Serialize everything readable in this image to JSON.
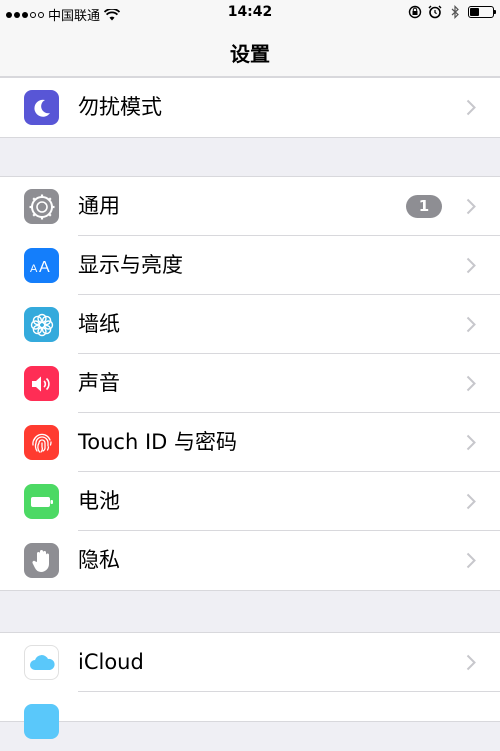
{
  "status_bar": {
    "carrier": "中国联通",
    "time": "14:42"
  },
  "nav": {
    "title": "设置"
  },
  "groups": [
    {
      "items": [
        {
          "label": "勿扰模式",
          "icon": "moon-icon",
          "color": "#5856d6"
        }
      ]
    },
    {
      "items": [
        {
          "label": "通用",
          "icon": "gear-icon",
          "color": "#8e8e93",
          "badge": "1"
        },
        {
          "label": "显示与亮度",
          "icon": "text-size-icon",
          "color": "#147efb"
        },
        {
          "label": "墙纸",
          "icon": "flower-icon",
          "color": "#34aadc"
        },
        {
          "label": "声音",
          "icon": "speaker-icon",
          "color": "#ff2d55"
        },
        {
          "label": "Touch ID 与密码",
          "icon": "fingerprint-icon",
          "color": "#ff3b30"
        },
        {
          "label": "电池",
          "icon": "battery-icon",
          "color": "#4cd964"
        },
        {
          "label": "隐私",
          "icon": "hand-icon",
          "color": "#8e8e93"
        }
      ]
    },
    {
      "items": [
        {
          "label": "iCloud",
          "icon": "cloud-icon",
          "color": "#ffffff"
        }
      ]
    }
  ]
}
